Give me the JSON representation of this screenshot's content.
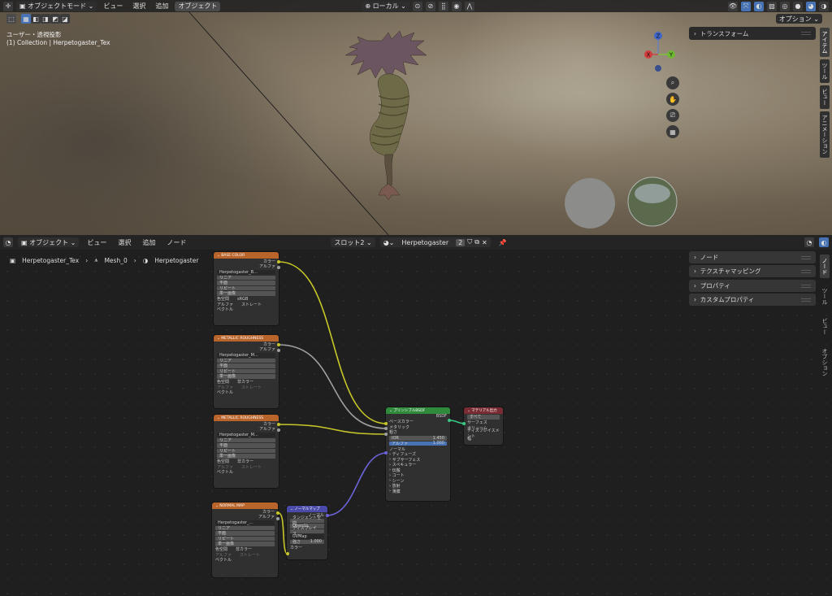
{
  "viewport": {
    "header": {
      "mode": "オブジェクトモード",
      "menu": [
        "ビュー",
        "選択",
        "追加",
        "オブジェクト"
      ],
      "transform_orientation": "ローカル",
      "options_label": "オプション"
    },
    "overlay_text": {
      "view": "ユーザー・透視投影",
      "collection": "(1) Collection | Herpetogaster_Tex"
    },
    "sidebar_panel": "トランスフォーム",
    "side_tabs": [
      "アイテム",
      "ツール",
      "ビュー",
      "アニメーション"
    ],
    "gizmo": {
      "x": "X",
      "y": "Y",
      "z": "Z"
    }
  },
  "editor": {
    "header": {
      "mode": "オブジェクト",
      "menu": [
        "ビュー",
        "選択",
        "追加",
        "ノード"
      ],
      "slot": "スロット2",
      "material": "Herpetogaster",
      "users": "2"
    },
    "breadcrumb": [
      "Herpetogaster_Tex",
      "Mesh_0",
      "Herpetogaster"
    ],
    "side_panels": [
      "ノード",
      "テクスチャマッピング",
      "プロパティ",
      "カスタムプロパティ"
    ],
    "side_tabs": [
      "ノード",
      "ツール",
      "ビュー",
      "オプション"
    ],
    "nodes": {
      "tex1": {
        "title": "BASE COLOR",
        "out_color": "カラー",
        "out_alpha": "アルファ",
        "image": "Herpetogaster_B...",
        "rows": [
          "リニア",
          "平面",
          "リピート",
          "単一画像"
        ],
        "colorspace_label": "色空間",
        "colorspace": "sRGB",
        "alpha_label": "アルファ",
        "alpha": "ストレート",
        "vector": "ベクトル"
      },
      "tex2": {
        "title": "METALLIC ROUGHNESS",
        "out_color": "カラー",
        "out_alpha": "アルファ",
        "image": "Herpetogaster_M...",
        "rows": [
          "リニア",
          "平面",
          "リピート",
          "単一画像"
        ],
        "colorspace_label": "色空間",
        "colorspace": "非カラー",
        "alpha_label": "アルファ",
        "alpha": "ストレート",
        "vector": "ベクトル"
      },
      "tex3": {
        "title": "METALLIC ROUGHNESS",
        "out_color": "カラー",
        "out_alpha": "アルファ",
        "image": "Herpetogaster_M...",
        "rows": [
          "リニア",
          "平面",
          "リピート",
          "単一画像"
        ],
        "colorspace_label": "色空間",
        "colorspace": "非カラー",
        "alpha_label": "アルファ",
        "alpha": "ストレート",
        "vector": "ベクトル"
      },
      "tex4": {
        "title": "NORMAL MAP",
        "out_color": "カラー",
        "out_alpha": "アルファ",
        "image": "Herpetogaster_...",
        "rows": [
          "リニア",
          "平面",
          "リピート",
          "単一画像"
        ],
        "colorspace_label": "色空間",
        "colorspace": "非カラー",
        "alpha_label": "アルファ",
        "alpha": "ストレート",
        "vector": "ベクトル"
      },
      "normalmap": {
        "title": "ノーマルマップ",
        "out": "ノーマル",
        "space": "タンジェント空間",
        "convention": "OpenGL",
        "mode": "ディスプレイス...",
        "uv": "UVMap",
        "strength_label": "強さ",
        "strength": "1.000",
        "in_color": "カラー"
      },
      "bsdf": {
        "title": "プリンシプルBSDF",
        "out": "BSDF",
        "inputs": [
          "ベースカラー",
          "メタリック",
          "粗さ"
        ],
        "ior_label": "IOR",
        "ior": "1.450",
        "alpha_label": "アルファ",
        "alpha": "1.000",
        "normal": "ノーマル",
        "sections": [
          "ディフューズ",
          "サブサーフェス",
          "スペキュラー",
          "伝搬",
          "コート",
          "シーン",
          "放射",
          "薄膜"
        ]
      },
      "output": {
        "title": "マテリアル出力",
        "target": "すべて",
        "inputs": [
          "サーフェス",
          "ボリューム",
          "ディスプレイスメント",
          "幅"
        ]
      }
    }
  },
  "colors": {
    "texture_header": "#b8642b",
    "shader_header": "#2f8a3b",
    "output_header": "#7a2c34",
    "vector_header": "#4a4aa8",
    "accent_blue": "#4772b3"
  }
}
